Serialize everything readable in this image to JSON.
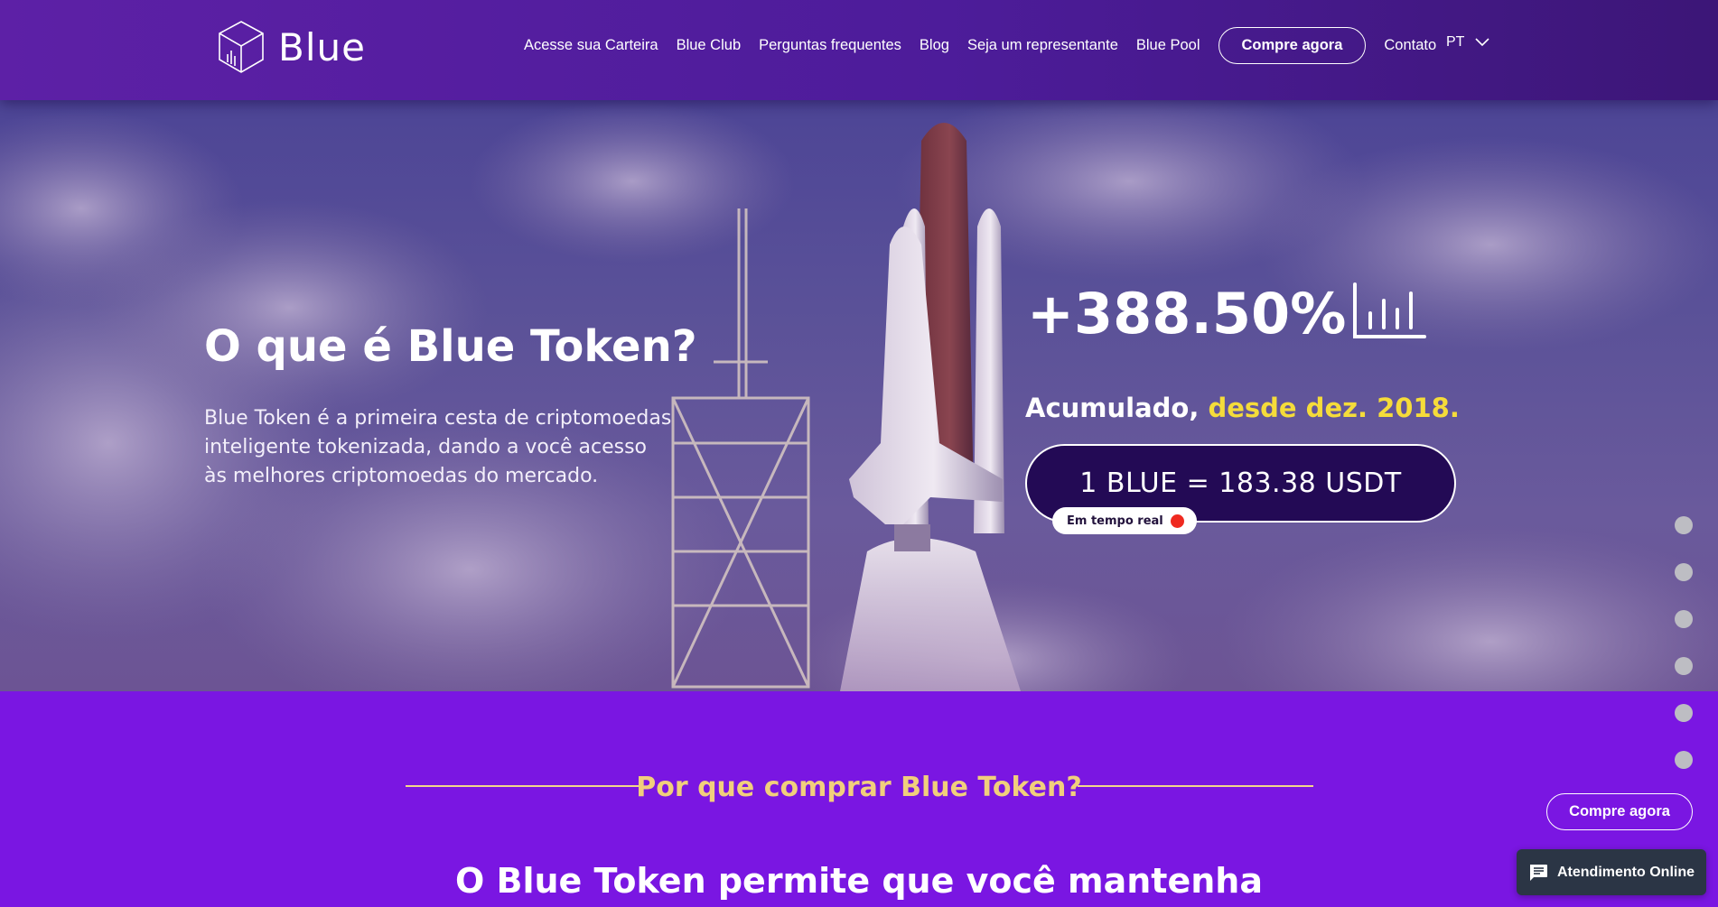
{
  "brand": {
    "name": "Blue",
    "logo_icon": "cube-chart-logo"
  },
  "nav": {
    "links": [
      "Acesse sua Carteira",
      "Blue Club",
      "Perguntas frequentes",
      "Blog",
      "Seja um representante",
      "Blue Pool"
    ],
    "cta": "Compre agora",
    "contact": "Contato",
    "language": "PT",
    "language_icon": "chevron-down-icon"
  },
  "hero": {
    "title": "O que é Blue Token?",
    "description": "Blue Token é a primeira cesta de criptomoedas inteligente tokenizada, dando a você acesso às melhores criptomoedas do mercado.",
    "stat_value": "+388.50%",
    "stat_icon": "bar-chart-icon",
    "cumulative_label": "Acumulado,",
    "cumulative_highlight": "desde dez. 2018.",
    "price": "1 BLUE = 183.38 USDT",
    "realtime_label": "Em tempo real",
    "highlight_color": "#f5dc3a",
    "live_color": "#ef2a20"
  },
  "section": {
    "heading": "Por que comprar Blue Token?",
    "subheading": "O Blue Token permite que você mantenha"
  },
  "floating": {
    "cta": "Compre agora",
    "chat": "Atendimento Online",
    "chat_icon": "chat-bubble-icon"
  },
  "colors": {
    "nav_bg": "#4d1c9a",
    "section_bg": "#7a16e2",
    "price_pill_bg": "#230a55",
    "section_heading": "#f1cf7c"
  },
  "scroll_dots_count": 6
}
